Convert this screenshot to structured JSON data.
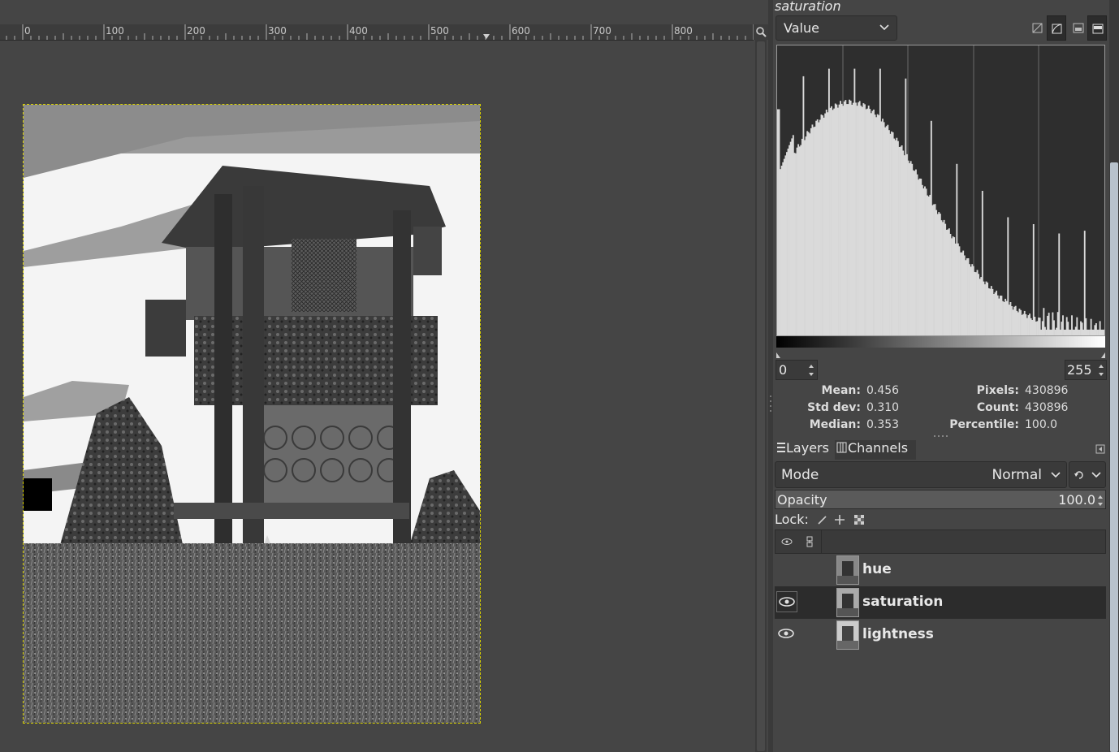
{
  "ruler": {
    "labels": [
      "0",
      "100",
      "200",
      "300",
      "400",
      "500",
      "600",
      "700",
      "800"
    ]
  },
  "histogram": {
    "title": "saturation",
    "channel": "Value",
    "range_min": "0",
    "range_max": "255",
    "stats": {
      "mean_label": "Mean:",
      "mean": "0.456",
      "stddev_label": "Std dev:",
      "stddev": "0.310",
      "median_label": "Median:",
      "median": "0.353",
      "pixels_label": "Pixels:",
      "pixels": "430896",
      "count_label": "Count:",
      "count": "430896",
      "percentile_label": "Percentile:",
      "percentile": "100.0"
    }
  },
  "layers_dock": {
    "tab_layers": "Layers",
    "tab_channels": "Channels",
    "mode_label": "Mode",
    "mode_value": "Normal",
    "opacity_label": "Opacity",
    "opacity_value": "100.0",
    "lock_label": "Lock:",
    "layers": [
      {
        "name": "hue",
        "visible": false,
        "selected": false
      },
      {
        "name": "saturation",
        "visible": true,
        "selected": true
      },
      {
        "name": "lightness",
        "visible": true,
        "selected": false
      }
    ]
  },
  "colors": {
    "background": "#454545",
    "selection_border": "#d8d000",
    "histogram_fill": "#dadada"
  }
}
